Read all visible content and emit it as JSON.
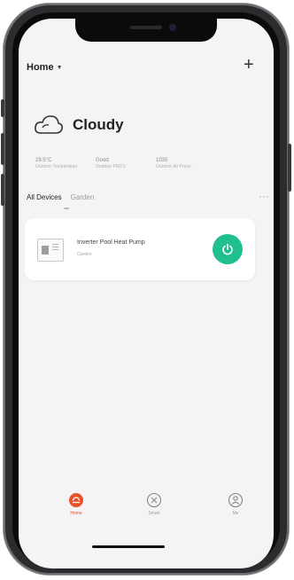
{
  "header": {
    "home_label": "Home"
  },
  "weather": {
    "condition": "Cloudy",
    "stats": [
      {
        "value": "29.5°C",
        "label": "Outdoor Temperature"
      },
      {
        "value": "Good",
        "label": "Outdoor PM2.5"
      },
      {
        "value": "1035",
        "label": "Outdoor Air Press."
      }
    ]
  },
  "tabs": [
    {
      "label": "All Devices",
      "active": true
    },
    {
      "label": "Garden",
      "active": false
    }
  ],
  "devices": [
    {
      "name": "Inverter Pool Heat Pump",
      "room": "Garden",
      "power_color": "#1fbf8f"
    }
  ],
  "tabbar": [
    {
      "label": "Home",
      "icon": "home-icon",
      "active": true,
      "color": "#e8512a"
    },
    {
      "label": "Smart",
      "icon": "smart-icon",
      "active": false,
      "color": "#999999"
    },
    {
      "label": "Me",
      "icon": "me-icon",
      "active": false,
      "color": "#999999"
    }
  ]
}
